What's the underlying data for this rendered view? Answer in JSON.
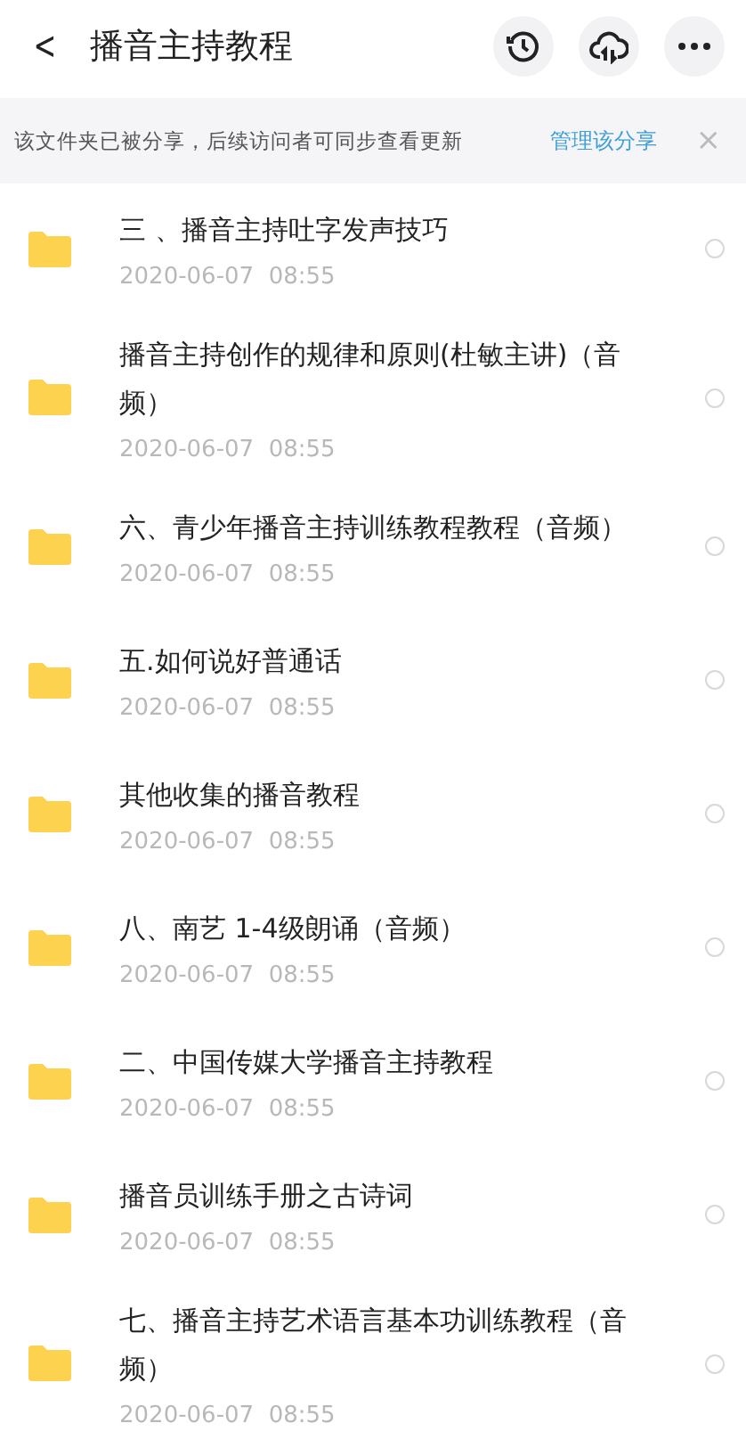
{
  "header": {
    "back": "<",
    "title": "播音主持教程"
  },
  "banner": {
    "text": "该文件夹已被分享，后续访问者可同步查看更新",
    "link": "管理该分享",
    "close": "×"
  },
  "files": [
    {
      "name": "三 、播音主持吐字发声技巧",
      "date": "2020-06-07  08:55",
      "selected": false
    },
    {
      "name": "播音主持创作的规律和原则(杜敏主讲)（音频）",
      "date": "2020-06-07  08:55",
      "selected": false
    },
    {
      "name": "六、青少年播音主持训练教程教程（音频）",
      "date": "2020-06-07  08:55",
      "selected": false
    },
    {
      "name": "五.如何说好普通话",
      "date": "2020-06-07  08:55",
      "selected": false
    },
    {
      "name": "其他收集的播音教程",
      "date": "2020-06-07  08:55",
      "selected": false
    },
    {
      "name": "八、南艺 1-4级朗诵（音频）",
      "date": "2020-06-07  08:55",
      "selected": false
    },
    {
      "name": "二、中国传媒大学播音主持教程",
      "date": "2020-06-07  08:55",
      "selected": false
    },
    {
      "name": "播音员训练手册之古诗词",
      "date": "2020-06-07  08:55",
      "selected": false
    },
    {
      "name": "七、播音主持艺术语言基本功训练教程（音频）",
      "date": "2020-06-07  08:55",
      "selected": false
    }
  ]
}
